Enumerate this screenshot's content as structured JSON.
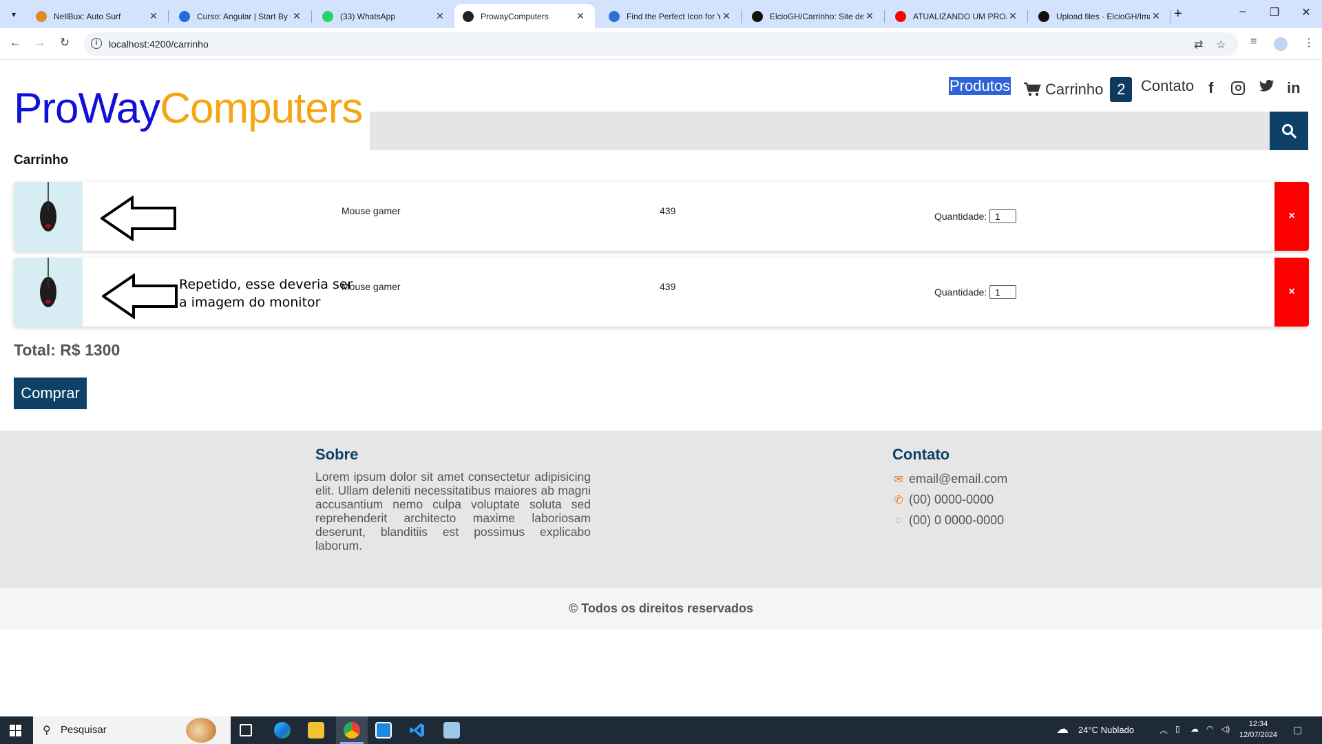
{
  "browser": {
    "tabs": [
      {
        "title": "NellBux: Auto Surf",
        "active": false,
        "favicon_color": "#e0892a"
      },
      {
        "title": "Curso: Angular | Start By C",
        "active": false,
        "favicon_color": "#1e6fd9"
      },
      {
        "title": "(33) WhatsApp",
        "active": false,
        "favicon_color": "#25d366"
      },
      {
        "title": "ProwayComputers",
        "active": true,
        "favicon_color": "#222222"
      },
      {
        "title": "Find the Perfect Icon for Y",
        "active": false,
        "favicon_color": "#2f6fd8"
      },
      {
        "title": "ElcioGH/Carrinho: Site de",
        "active": false,
        "favicon_color": "#111111"
      },
      {
        "title": "ATUALIZANDO UM PROJE",
        "active": false,
        "favicon_color": "#ff0000"
      },
      {
        "title": "Upload files · ElcioGH/Ima",
        "active": false,
        "favicon_color": "#111111"
      }
    ],
    "url": "localhost:4200/carrinho"
  },
  "header": {
    "logo_part1": "ProWay",
    "logo_part2": "Computers",
    "nav_produtos": "Produtos",
    "nav_carrinho": "Carrinho",
    "cart_count": "2",
    "nav_contato": "Contato"
  },
  "page": {
    "title": "Carrinho",
    "items": [
      {
        "name": "Mouse gamer",
        "price": "439",
        "qty_label": "Quantidade:",
        "qty": "1",
        "remove": "×"
      },
      {
        "name": "Mouse gamer",
        "price": "439",
        "qty_label": "Quantidade:",
        "qty": "1",
        "remove": "×"
      }
    ],
    "annotation_line1": "Repetido, esse deveria ser",
    "annotation_line2": "a imagem do monitor",
    "total": "Total: R$ 1300",
    "buy": "Comprar"
  },
  "footer": {
    "about_title": "Sobre",
    "about_text": "Lorem ipsum dolor sit amet consectetur adipisicing elit. Ullam deleniti necessitatibus maiores ab magni accusantium nemo culpa voluptate soluta sed reprehenderit architecto maxime laboriosam deserunt, blanditiis est possimus explicabo laborum.",
    "contact_title": "Contato",
    "email": "email@email.com",
    "phone": "(00) 0000-0000",
    "whatsapp": "(00) 0 0000-0000",
    "copyright": "© Todos os direitos reservados"
  },
  "taskbar": {
    "search_placeholder": "Pesquisar",
    "weather": "24°C  Nublado",
    "time": "12:34",
    "date": "12/07/2024"
  },
  "colors": {
    "logo_blue": "#1010d8",
    "logo_orange": "#f5a511",
    "brand_navy": "#0d4168",
    "remove_red": "#ff0000"
  }
}
